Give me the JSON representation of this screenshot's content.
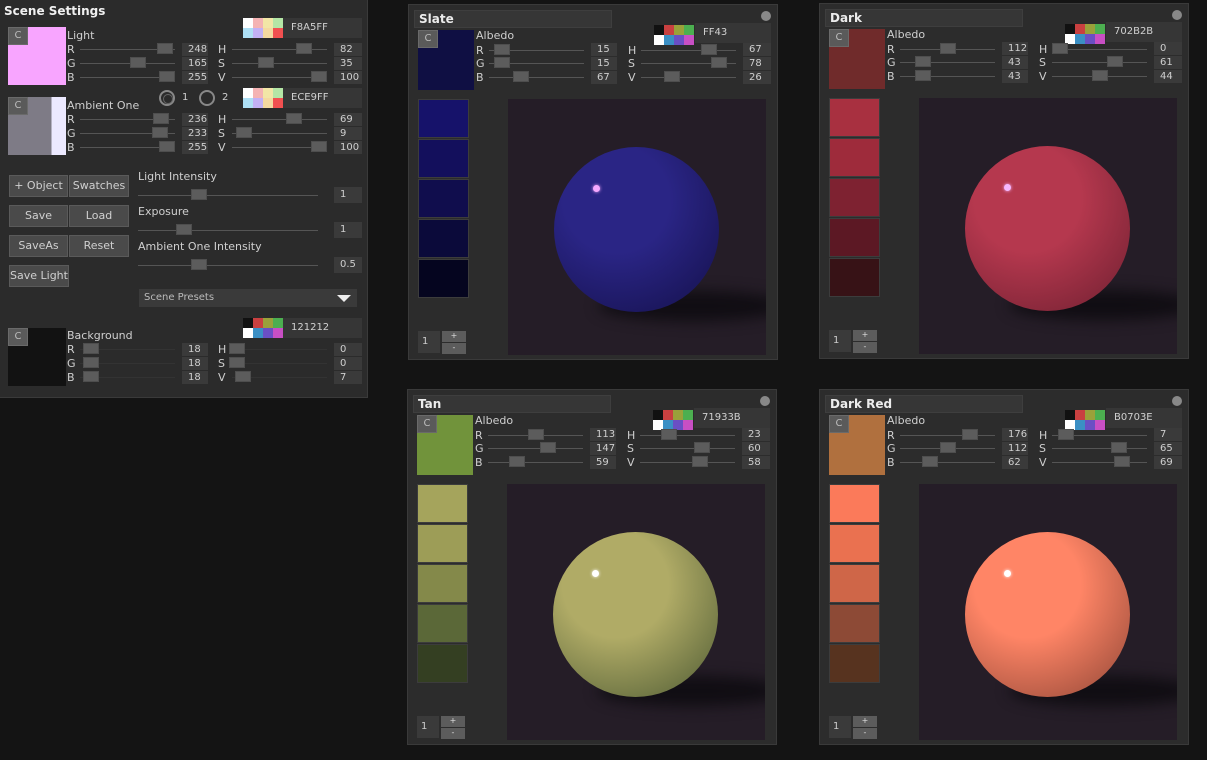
{
  "scene": {
    "title": "Scene Settings",
    "light": {
      "label": "Light",
      "color": "#f8a5ff",
      "hex": "F8A5FF",
      "rgb": {
        "R": 248,
        "G": 165,
        "B": 255
      },
      "hsv": {
        "H": 82,
        "S": 35,
        "V": 100
      },
      "palette": [
        "#ffffff",
        "#f4b3b3",
        "#f2e6a6",
        "#b4e6a6",
        "#aee0f5",
        "#c2b1f5",
        "#f4d9a0",
        "#f25050"
      ]
    },
    "ambient": {
      "label": "Ambient One",
      "color": "#ece9ff",
      "shade": "#7e7b86",
      "hex": "ECE9FF",
      "rgb": {
        "R": 236,
        "G": 233,
        "B": 255
      },
      "hsv": {
        "H": 69,
        "S": 9,
        "V": 100
      },
      "palette": [
        "#ffffff",
        "#f4b3b3",
        "#f2e6a6",
        "#b4e6a6",
        "#aee0f5",
        "#c2b1f5",
        "#f4d9a0",
        "#f25050"
      ],
      "radio_1": "1",
      "radio_2": "2"
    },
    "buttons": {
      "add_object": "+ Object",
      "swatches": "Swatches",
      "save": "Save",
      "load": "Load",
      "save_as": "SaveAs",
      "reset": "Reset",
      "save_light": "Save Light"
    },
    "sliders": {
      "light_intensity": {
        "label": "Light Intensity",
        "value": "1"
      },
      "exposure": {
        "label": "Exposure",
        "value": "1"
      },
      "ambient_intensity": {
        "label": "Ambient One Intensity",
        "value": "0.5"
      }
    },
    "presets": {
      "selected": "Scene Presets"
    },
    "background": {
      "label": "Background",
      "color": "#121212",
      "hex": "121212",
      "rgb": {
        "R": 18,
        "G": 18,
        "B": 18
      },
      "hsv": {
        "H": 0,
        "S": 0,
        "V": 7
      },
      "palette": [
        "#111111",
        "#c94040",
        "#9aa13a",
        "#4caf50",
        "#ffffff",
        "#3b8fc4",
        "#6a4fc4",
        "#c84fc4"
      ]
    },
    "c_label": "C"
  },
  "materials": [
    {
      "name": "Slate",
      "albedo_label": "Albedo",
      "color": "#0f0f43",
      "hex": "FF43",
      "rgb": {
        "R": 15,
        "G": 15,
        "B": 67
      },
      "hsv": {
        "H": 67,
        "S": 78,
        "V": 26
      },
      "shades": [
        "#16126a",
        "#130f5c",
        "#100d4d",
        "#0b0a3a",
        "#05051f"
      ],
      "sphere_light": "#2a2585",
      "sphere_dark": "#14104a",
      "spec_color": "#f5a8ff",
      "counter": "1",
      "plus": "+",
      "minus": "-"
    },
    {
      "name": "Dark",
      "albedo_label": "Albedo",
      "color": "#702b2b",
      "hex": "702B2B",
      "rgb": {
        "R": 112,
        "G": 43,
        "B": 43
      },
      "hsv": {
        "H": 0,
        "S": 61,
        "V": 44
      },
      "shades": [
        "#a83040",
        "#9e2b3b",
        "#7e2231",
        "#5c1824",
        "#371216"
      ],
      "sphere_light": "#b5384e",
      "sphere_dark": "#6e1f30",
      "spec_color": "#f5b8ff",
      "counter": "1",
      "plus": "+",
      "minus": "-"
    },
    {
      "name": "Tan",
      "albedo_label": "Albedo",
      "color": "#71933b",
      "hex": "71933B",
      "rgb": {
        "R": 113,
        "G": 147,
        "B": 59
      },
      "hsv": {
        "H": 23,
        "S": 60,
        "V": 58
      },
      "shades": [
        "#a5a45c",
        "#9d9d57",
        "#84894a",
        "#5b6838",
        "#343f22"
      ],
      "sphere_light": "#b0ab66",
      "sphere_dark": "#4d5a33",
      "spec_color": "#ffffff",
      "counter": "1",
      "plus": "+",
      "minus": "-"
    },
    {
      "name": "Dark Red",
      "albedo_label": "Albedo",
      "color": "#b0703e",
      "hex": "B0703E",
      "rgb": {
        "R": 176,
        "G": 112,
        "B": 62
      },
      "hsv": {
        "H": 7,
        "S": 65,
        "V": 69
      },
      "shades": [
        "#fb7a5a",
        "#ea7150",
        "#cf6648",
        "#8d4a36",
        "#57331f"
      ],
      "sphere_light": "#ff8566",
      "sphere_dark": "#8e4535",
      "spec_color": "#ffffff",
      "counter": "1",
      "plus": "+",
      "minus": "-"
    }
  ]
}
